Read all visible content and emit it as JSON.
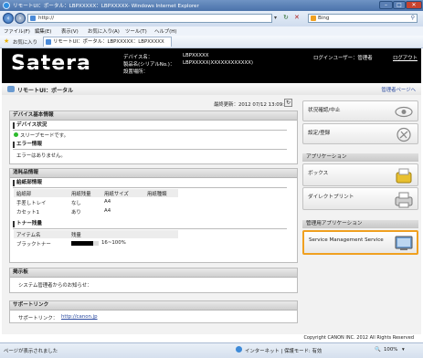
{
  "window": {
    "title": "リモートUI：ポータル：LBPXXXXX：LBPXXXXX- Windows Internet Explorer",
    "address": "http://",
    "search_placeholder": "Bing",
    "menu": [
      "ファイル(F)",
      "編集(E)",
      "表示(V)",
      "お気に入り(A)",
      "ツール(T)",
      "ヘルプ(H)"
    ],
    "favorites_label": "お気に入り",
    "tab_label": "リモートUI：ポータル：LBPXXXXX：LBPXXXXX"
  },
  "header": {
    "logo": "Satera",
    "device_name_label": "デバイス名：",
    "device_name_value": "LBPXXXXX",
    "product_label": "製品名(シリアルNo.)：",
    "product_value": "LBPXXXXX(XXXXXXXXXXXX)",
    "location_label": "設置場所：",
    "login_user": "ログインユーザー：管理者",
    "logout": "ログアウト"
  },
  "subheader": {
    "title": "リモートUI：ポータル",
    "admin_link": "管理者ページへ"
  },
  "update": {
    "label": "最終更新：2012 07/12 13:09:58"
  },
  "device_basic": {
    "title": "デバイス基本情報",
    "status_heading": "デバイス状況",
    "status_text": "スリープモードです。",
    "error_heading": "エラー情報",
    "error_text": "エラーはありません。"
  },
  "consumables": {
    "title": "消耗品情報",
    "paper_heading": "給紙部情報",
    "paper_columns": [
      "給紙部",
      "用紙残量",
      "用紙サイズ",
      "用紙種類"
    ],
    "paper_rows": [
      [
        "手差しトレイ",
        "なし",
        "A4",
        ""
      ],
      [
        "カセット1",
        "あり",
        "A4",
        ""
      ]
    ],
    "toner_heading": "トナー残量",
    "toner_columns": [
      "アイテム名",
      "残量"
    ],
    "toner_rows": [
      [
        "ブラックトナー",
        "16~100%"
      ]
    ],
    "toner_level_fraction": 0.8
  },
  "notice": {
    "title": "掲示板",
    "text": "システム管理者からのお知らせ："
  },
  "support": {
    "title": "サポートリンク",
    "label": "サポートリンク：",
    "url": "http://canon.jp"
  },
  "right": {
    "status_button": "状況確認/中止",
    "settings_button": "設定/登録",
    "apps_heading": "アプリケーション",
    "box_button": "ボックス",
    "direct_print_button": "ダイレクトプリント",
    "mgmt_heading": "管理用アプリケーション",
    "service_button": "Service Management Service"
  },
  "footer": {
    "copyright": "Copyright CANON INC. 2012 All Rights Reserved"
  },
  "statusbar": {
    "left": "ページが表示されました",
    "zone": "インターネット | 保護モード: 有効",
    "zoom": "100%"
  },
  "colors": {
    "accent_orange": "#f0a020",
    "header_black": "#000000",
    "status_green": "#2dbb2d"
  }
}
